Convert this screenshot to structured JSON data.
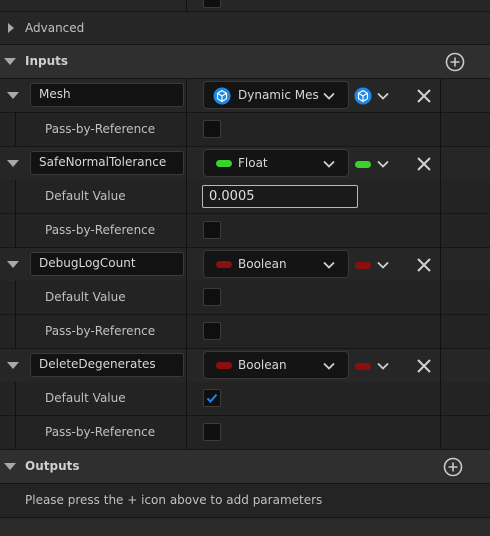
{
  "sections": {
    "advanced": "Advanced",
    "inputs": "Inputs",
    "outputs": "Outputs",
    "outputs_hint": "Please press the + icon above to add parameters"
  },
  "inputs": [
    {
      "name": "Mesh",
      "type": "Dynamic Mes",
      "type_icon": "dynamic-mesh-icon",
      "color": "#1e88e5",
      "props": [
        {
          "label": "Pass-by-Reference",
          "kind": "checkbox",
          "checked": false
        }
      ]
    },
    {
      "name": "SafeNormalTolerance",
      "type": "Float",
      "type_icon": "float-pill",
      "color": "#39d32b",
      "props": [
        {
          "label": "Default Value",
          "kind": "text",
          "value": "0.0005"
        },
        {
          "label": "Pass-by-Reference",
          "kind": "checkbox",
          "checked": false
        }
      ]
    },
    {
      "name": "DebugLogCount",
      "type": "Boolean",
      "type_icon": "boolean-pill",
      "color": "#8b0f0f",
      "props": [
        {
          "label": "Default Value",
          "kind": "checkbox",
          "checked": false
        },
        {
          "label": "Pass-by-Reference",
          "kind": "checkbox",
          "checked": false
        }
      ]
    },
    {
      "name": "DeleteDegenerates",
      "type": "Boolean",
      "type_icon": "boolean-pill",
      "color": "#8b0f0f",
      "props": [
        {
          "label": "Default Value",
          "kind": "checkbox",
          "checked": true
        },
        {
          "label": "Pass-by-Reference",
          "kind": "checkbox",
          "checked": false
        }
      ]
    }
  ],
  "colors": {
    "accent": "#1e88e5",
    "check": "#1e88e5"
  }
}
